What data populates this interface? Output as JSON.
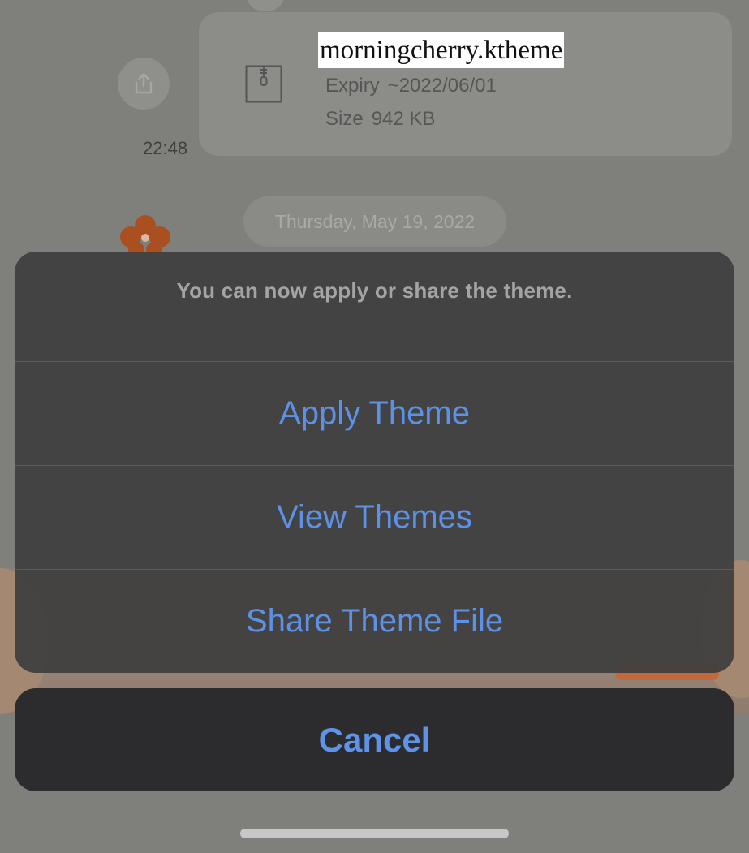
{
  "chat": {
    "file": {
      "name": "morningcherry.ktheme",
      "expiry_label": "Expiry",
      "expiry_value": "~2022/06/01",
      "size_label": "Size",
      "size_value": "942 KB",
      "icon": "zip-file-icon"
    },
    "message_time": "22:48",
    "date_divider": "Thursday, May 19, 2022",
    "share_icon": "share-icon",
    "sticker_icon": "flower-icon"
  },
  "action_sheet": {
    "message": "You can now apply or share the theme.",
    "actions": [
      {
        "label": "Apply Theme"
      },
      {
        "label": "View Themes"
      },
      {
        "label": "Share Theme File"
      }
    ],
    "cancel_label": "Cancel"
  },
  "colors": {
    "action_blue": "#5d91e6",
    "sheet_bg": "#3e3e3e",
    "cancel_bg": "#2c2c2e"
  }
}
